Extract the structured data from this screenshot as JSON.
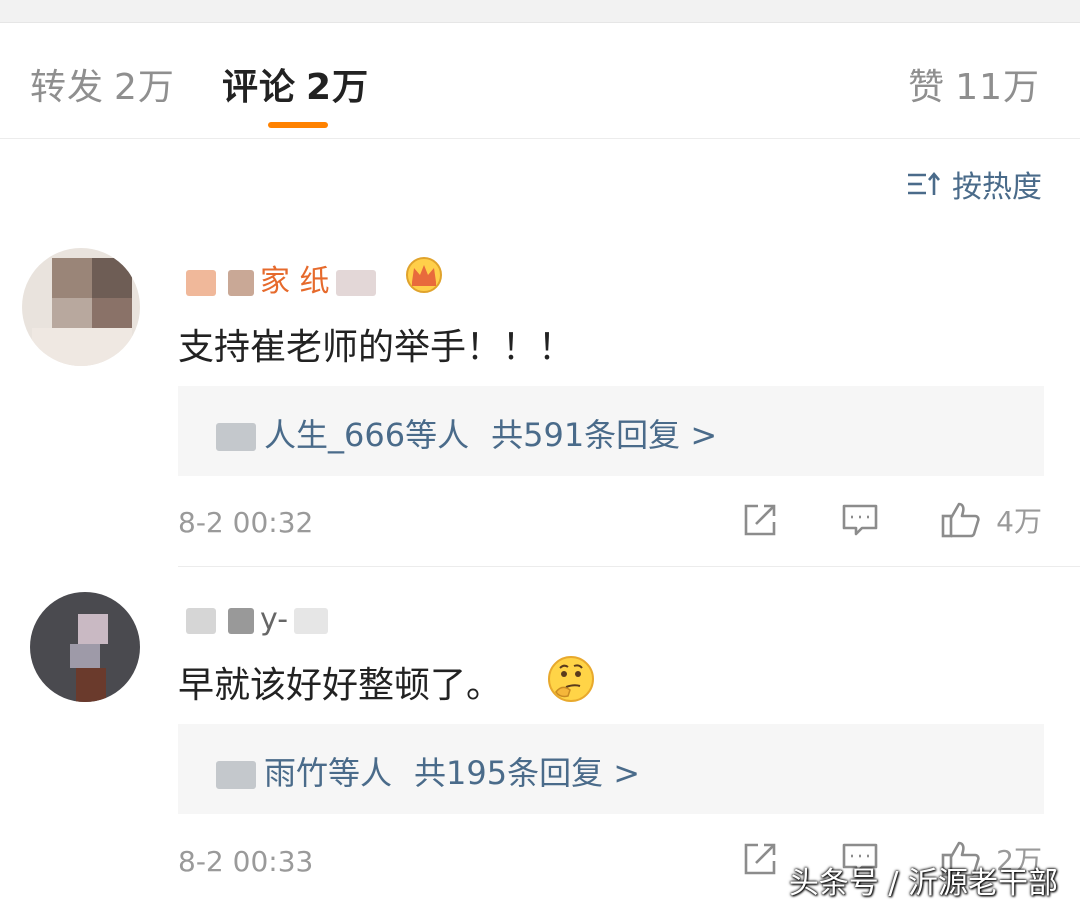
{
  "tabs": {
    "repost": {
      "label": "转发",
      "count": "2万"
    },
    "comment": {
      "label": "评论",
      "count": "2万"
    },
    "like": {
      "label": "赞",
      "count": "11万"
    }
  },
  "sort": {
    "label": "按热度"
  },
  "comments": [
    {
      "username": "家 纸",
      "text": "支持崔老师的举手！！！",
      "reply_users": "人生_666等人",
      "reply_total": "共591条回复 >",
      "time": "8-2 00:32",
      "likes": "4万"
    },
    {
      "username": "y-",
      "text": "早就该好好整顿了。",
      "reply_users": "雨竹等人",
      "reply_total": "共195条回复 >",
      "time": "8-2 00:33",
      "likes": "2万"
    }
  ],
  "watermark": "头条号 / 沂源老干部",
  "colors": {
    "accent": "#ff8200",
    "link": "#4a6b8a",
    "muted": "#9a9a9a"
  }
}
